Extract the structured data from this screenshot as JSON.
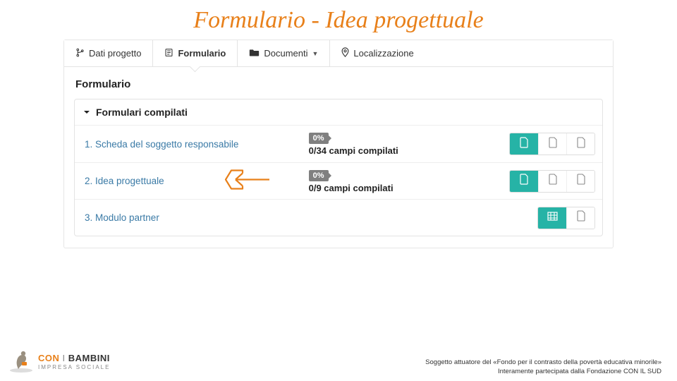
{
  "slide_title": "Formulario - Idea progettuale",
  "tabs": [
    {
      "label": "Dati progetto"
    },
    {
      "label": "Formulario"
    },
    {
      "label": "Documenti"
    },
    {
      "label": "Localizzazione"
    }
  ],
  "panel_title": "Formulario",
  "section_title": "Formulari compilati",
  "rows": [
    {
      "label": "1. Scheda del soggetto responsabile",
      "percent": "0%",
      "status": "0/34 campi compilati",
      "type": "progress"
    },
    {
      "label": "2. Idea progettuale",
      "percent": "0%",
      "status": "0/9 campi compilati",
      "type": "progress",
      "highlight": true
    },
    {
      "label": "3. Modulo partner",
      "type": "partner"
    }
  ],
  "logo": {
    "con": "CON",
    "mid": " I ",
    "bam": "BAMBINI",
    "sub": "IMPRESA SOCIALE"
  },
  "footer": {
    "line1": "Soggetto attuatore del «Fondo per il contrasto della povertà educativa minorile»",
    "line2": "Interamente partecipata dalla Fondazione CON IL SUD"
  }
}
